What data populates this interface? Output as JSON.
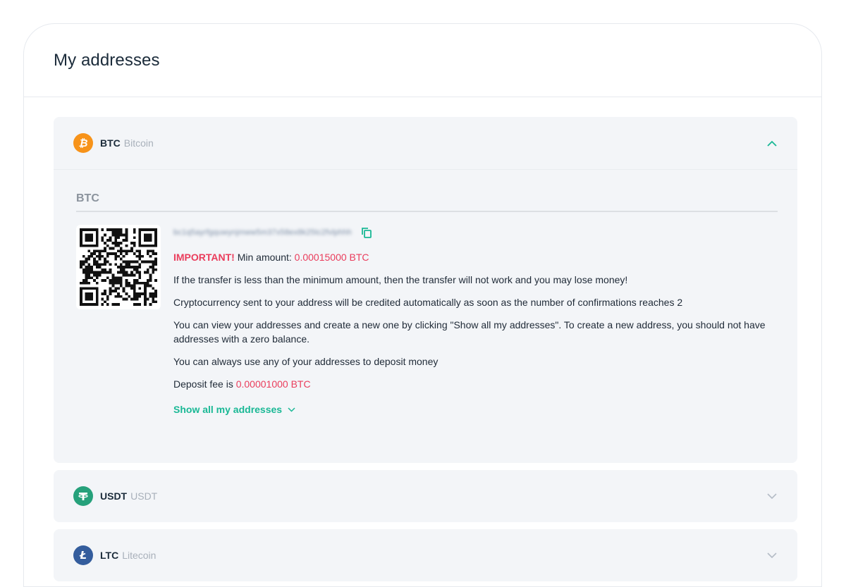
{
  "page": {
    "title": "My addresses"
  },
  "colors": {
    "accent": "#19b895",
    "danger": "#ea3d5c",
    "btc": "#f7931a",
    "usdt": "#26a17b",
    "ltc": "#345d9d"
  },
  "coins": [
    {
      "ticker": "BTC",
      "name": "Bitcoin",
      "icon": "bitcoin-icon",
      "expanded": true
    },
    {
      "ticker": "USDT",
      "name": "USDT",
      "icon": "tether-icon",
      "expanded": false
    },
    {
      "ticker": "LTC",
      "name": "Litecoin",
      "icon": "litecoin-icon",
      "expanded": false
    }
  ],
  "btc": {
    "section_title": "BTC",
    "address": "bc1q5ayrfgquwynjmww5m37x58ex8k25tc2fvlphhh",
    "important_label": "IMPORTANT!",
    "min_amount_label": " Min amount: ",
    "min_amount_value": "0.00015000 BTC",
    "notes": [
      "If the transfer is less than the minimum amount, then the transfer will not work and you may lose money!",
      "Cryptocurrency sent to your address will be credited automatically as soon as the number of confirmations reaches 2",
      "You can view your addresses and create a new one by clicking \"Show all my addresses\". To create a new address, you should not have addresses with a zero balance.",
      "You can always use any of your addresses to deposit money"
    ],
    "fee_label": "Deposit fee is ",
    "fee_value": "0.00001000 BTC",
    "show_all_label": "Show all my addresses"
  }
}
